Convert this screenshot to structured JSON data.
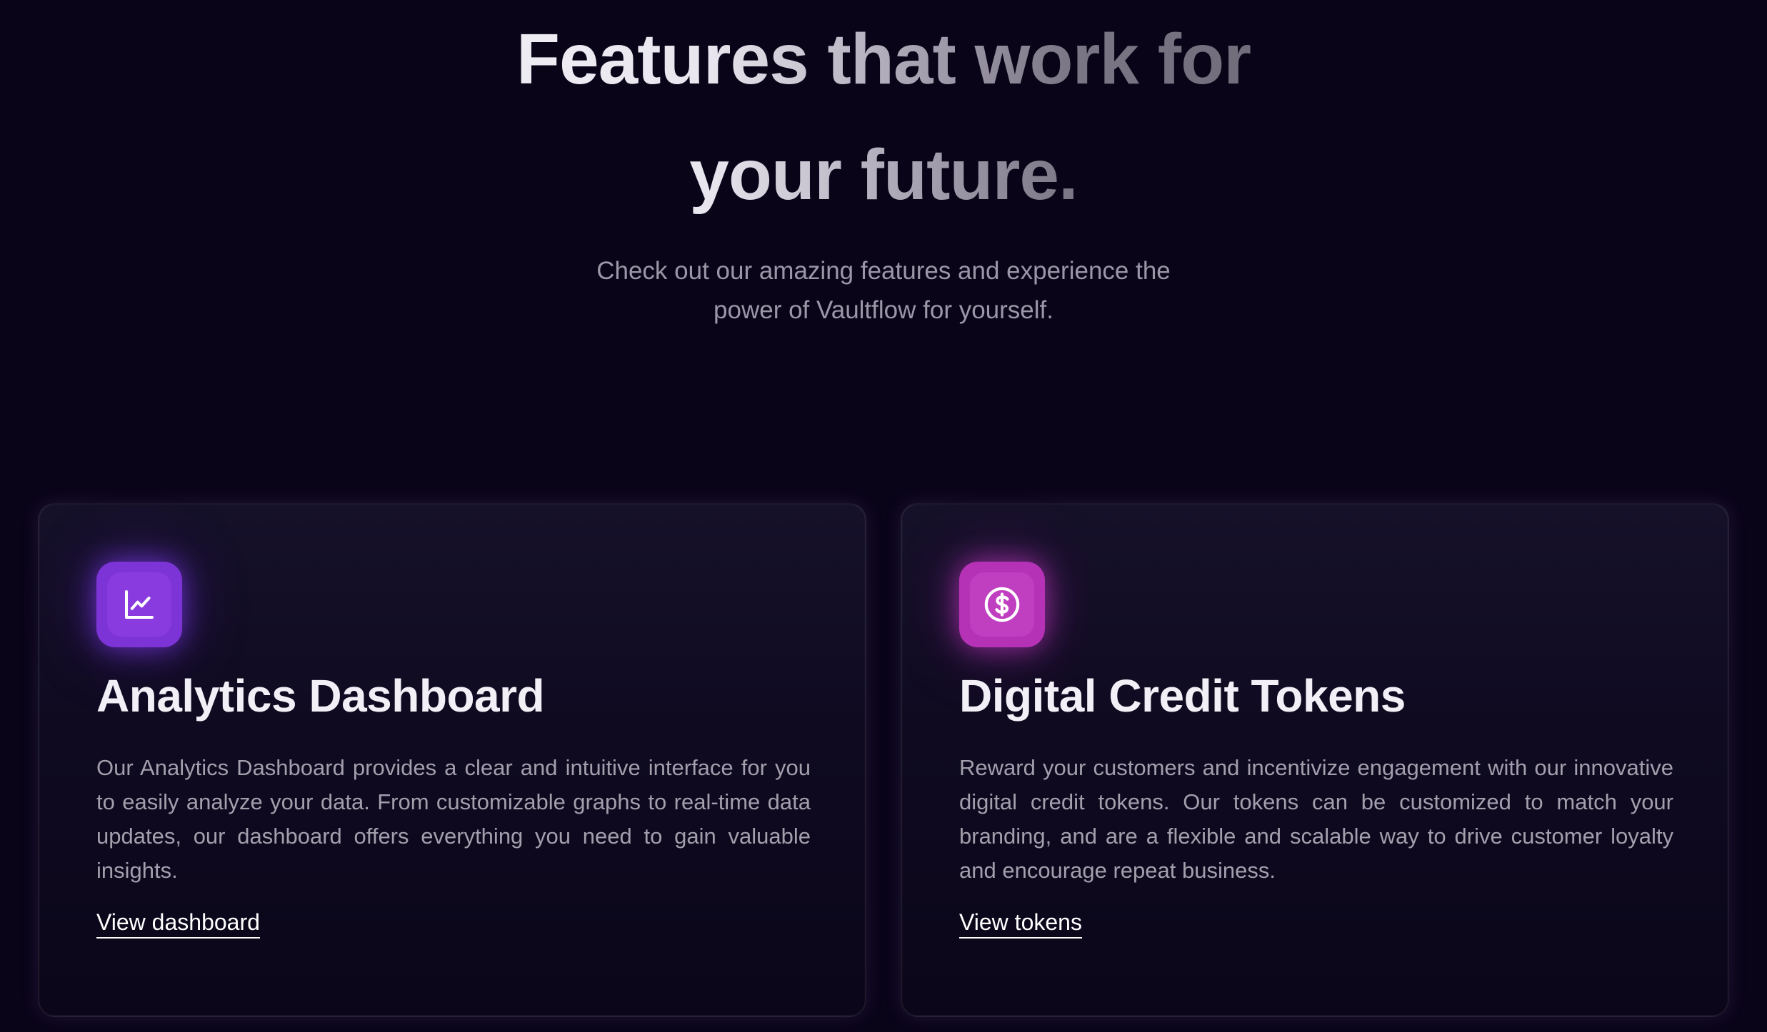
{
  "hero": {
    "title": "Features that work for your future.",
    "subtitle": "Check out our amazing features and experience the power of Vaultflow for yourself."
  },
  "cards": [
    {
      "icon": "chart-line-icon",
      "icon_color": "#7d34d6",
      "title": "Analytics Dashboard",
      "description": "Our Analytics Dashboard provides a clear and intuitive interface for you to easily analyze your data. From customizable graphs to real-time data updates, our dashboard offers everything you need to gain valuable insights.",
      "link_label": "View dashboard"
    },
    {
      "icon": "dollar-coin-icon",
      "icon_color": "#b532b6",
      "title": "Digital Credit Tokens",
      "description": "Reward your customers and incentivize engagement with our innovative digital credit tokens. Our tokens can be customized to match your branding, and are a flexible and scalable way to drive customer loyalty and encourage repeat business.",
      "link_label": "View tokens"
    }
  ],
  "colors": {
    "background": "#0a0419",
    "accent_purple": "#7d34d6",
    "accent_pink": "#b532b6"
  }
}
